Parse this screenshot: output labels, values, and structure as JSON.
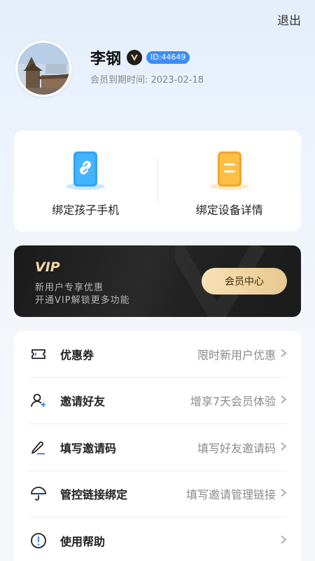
{
  "header": {
    "logout_label": "退出"
  },
  "profile": {
    "name": "李钢",
    "vip_badge": "V",
    "id_badge": "ID:44649",
    "expire_text": "会员到期时间:  2023-02-18"
  },
  "bind": {
    "items": [
      {
        "label": "绑定孩子手机",
        "icon": "link-phone-icon"
      },
      {
        "label": "绑定设备详情",
        "icon": "device-detail-icon"
      }
    ]
  },
  "vip": {
    "logo": "VIP",
    "line1": "新用户专享优惠",
    "line2": "开通VIP解锁更多功能",
    "button_label": "会员中心"
  },
  "menu": {
    "items": [
      {
        "label": "优惠券",
        "hint": "限时新用户优惠",
        "icon": "ticket-icon"
      },
      {
        "label": "邀请好友",
        "hint": "增享7天会员体验",
        "icon": "add-user-icon"
      },
      {
        "label": "填写邀请码",
        "hint": "填写好友邀请码",
        "icon": "pen-icon"
      },
      {
        "label": "管控链接绑定",
        "hint": "填写邀请管理链接",
        "icon": "umbrella-icon"
      },
      {
        "label": "使用帮助",
        "hint": "",
        "icon": "help-icon"
      }
    ]
  },
  "colors": {
    "accent": "#3d8cf8",
    "gold": "#e8c88f",
    "dark": "#1a1a1a"
  }
}
